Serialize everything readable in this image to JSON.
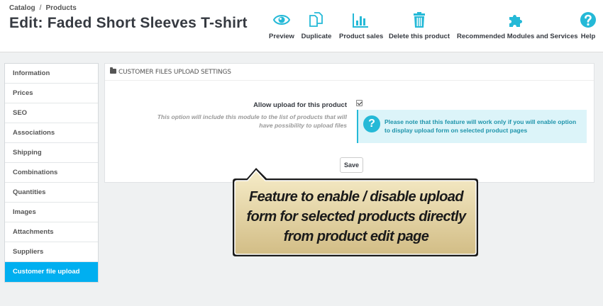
{
  "breadcrumb": {
    "catalog": "Catalog",
    "separator": "/",
    "products": "Products"
  },
  "page_title": "Edit: Faded Short Sleeves T-shirt",
  "toolbar": {
    "preview": "Preview",
    "duplicate": "Duplicate",
    "product_sales": "Product sales",
    "delete": "Delete this product",
    "recommended": "Recommended Modules and Services",
    "help": "Help"
  },
  "sidebar": {
    "items": [
      {
        "label": "Information"
      },
      {
        "label": "Prices"
      },
      {
        "label": "SEO"
      },
      {
        "label": "Associations"
      },
      {
        "label": "Shipping"
      },
      {
        "label": "Combinations"
      },
      {
        "label": "Quantities"
      },
      {
        "label": "Images"
      },
      {
        "label": "Attachments"
      },
      {
        "label": "Suppliers"
      },
      {
        "label": "Customer file upload"
      }
    ],
    "active_index": 10
  },
  "panel": {
    "heading": "CUSTOMER FILES UPLOAD SETTINGS",
    "field_label": "Allow upload for this product",
    "checkbox_checked": true,
    "help_text": "This option will include this module to the list of products that will have possibility to upload files",
    "alert_icon": "?",
    "alert_text": "Please note that this feature will work only if you will enable option to display upload form on selected product pages",
    "save_label": "Save"
  },
  "callout": {
    "line1": "Feature to enable / disable upload",
    "line2": "form for selected products directly",
    "line3": "from product edit page"
  },
  "colors": {
    "accent": "#00aff0",
    "alert_bg": "#dcf4f9",
    "alert_border": "#25b9d7",
    "icon": "#25b9d7",
    "callout_fill": "#d9c48f"
  }
}
